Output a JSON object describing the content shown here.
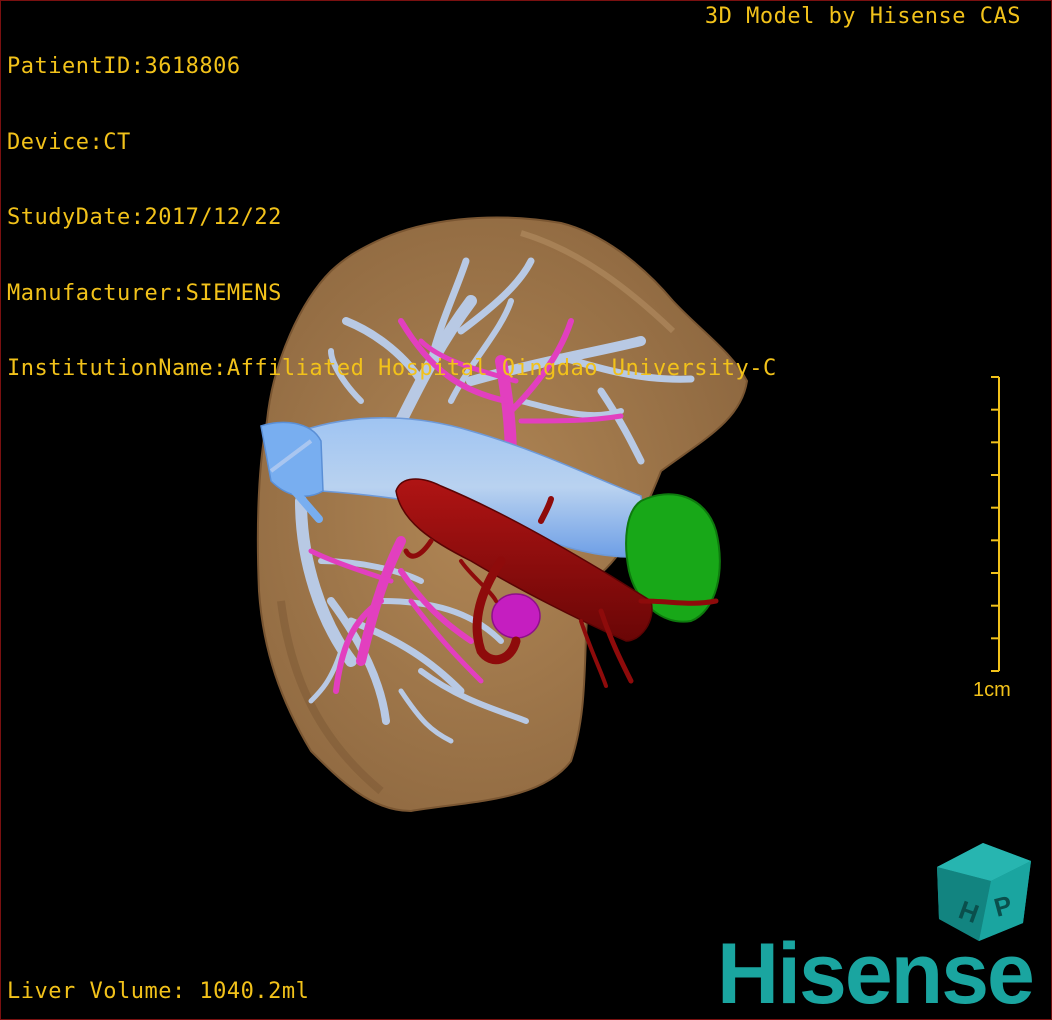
{
  "patient_info": {
    "patient_id": "PatientID:3618806",
    "device": "Device:CT",
    "study_date": "StudyDate:2017/12/22",
    "manufacturer": "Manufacturer:SIEMENS",
    "institution": "InstitutionName:Affiliated Hospital Qingdao University-C"
  },
  "credit": "3D Model by Hisense CAS",
  "liver_volume": "Liver Volume: 1040.2ml",
  "scale": {
    "label": "1cm",
    "tick_count": 10
  },
  "logo": {
    "wordmark": "Hisense",
    "cube_letters": [
      "H",
      "P"
    ]
  },
  "colors": {
    "overlay_text": "#f2c21a",
    "liver": "#a3784a",
    "portal_vein": "#b8c9e4",
    "hepatic_vein": "#e23fbf",
    "ivc": "#78aef0",
    "artery": "#8b0b0b",
    "tumor": "#18a818",
    "brand": "#1aa5a0"
  }
}
